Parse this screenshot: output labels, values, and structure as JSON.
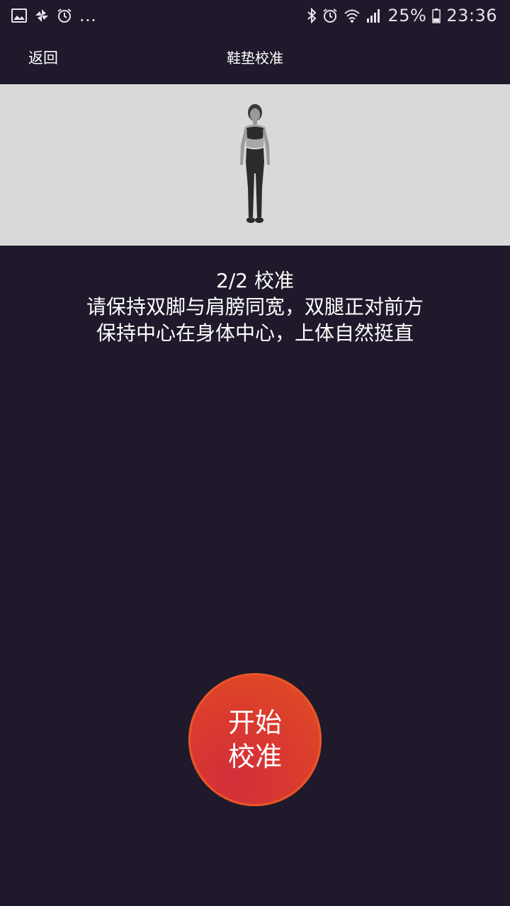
{
  "status_bar": {
    "left_icons": [
      "image-icon",
      "pinwheel-icon",
      "alarm-icon"
    ],
    "overflow": "...",
    "right_icons": [
      "bluetooth-icon",
      "alarm-icon",
      "wifi-icon",
      "signal-icon",
      "battery-icon"
    ],
    "battery_percent": "25%",
    "time": "23:36"
  },
  "header": {
    "back_label": "返回",
    "title": "鞋垫校准"
  },
  "illustration": {
    "icon": "standing-person-figure",
    "background_color": "#d9d9d9"
  },
  "instructions": {
    "step": "2/2 校准",
    "line1": "请保持双脚与肩膀同宽，双腿正对前方",
    "line2": "保持中心在身体中心，上体自然挺直"
  },
  "start_button": {
    "line1": "开始",
    "line2": "校准",
    "color": "#d9392f"
  },
  "colors": {
    "background": "#1f192b",
    "accent": "#e04f22"
  }
}
